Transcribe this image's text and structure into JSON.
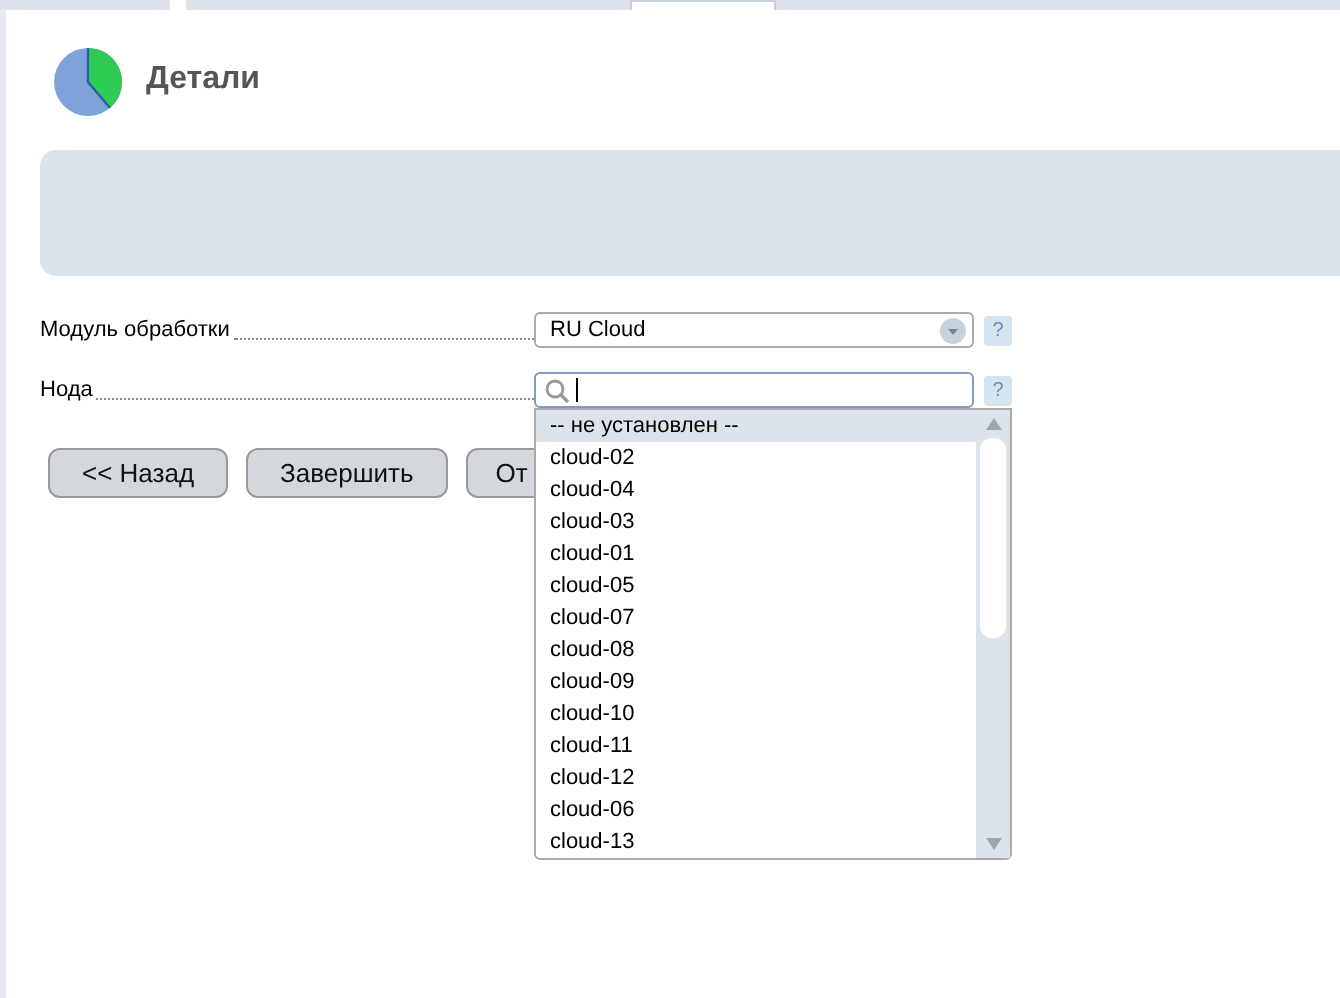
{
  "tabs": [
    {
      "selected": false
    },
    {
      "selected": false
    },
    {
      "selected": true
    },
    {
      "selected": false
    }
  ],
  "header": {
    "title": "Детали"
  },
  "fields": [
    {
      "label": "Модуль обработки",
      "kind": "select",
      "value": "RU Cloud",
      "help": "?"
    },
    {
      "label": "Нода",
      "kind": "search",
      "help": "?"
    }
  ],
  "buttons": [
    "<< Назад",
    "Завершить",
    "От"
  ],
  "dropdown": {
    "options": [
      {
        "text": "-- не установлен --",
        "selected": true
      },
      {
        "text": "cloud-02",
        "selected": false
      },
      {
        "text": "cloud-04",
        "selected": false
      },
      {
        "text": "cloud-03",
        "selected": false
      },
      {
        "text": "cloud-01",
        "selected": false
      },
      {
        "text": "cloud-05",
        "selected": false
      },
      {
        "text": "cloud-07",
        "selected": false
      },
      {
        "text": "cloud-08",
        "selected": false
      },
      {
        "text": "cloud-09",
        "selected": false
      },
      {
        "text": "cloud-10",
        "selected": false
      },
      {
        "text": "cloud-11",
        "selected": false
      },
      {
        "text": "cloud-12",
        "selected": false
      },
      {
        "text": "cloud-06",
        "selected": false
      },
      {
        "text": "cloud-13",
        "selected": false
      }
    ]
  }
}
